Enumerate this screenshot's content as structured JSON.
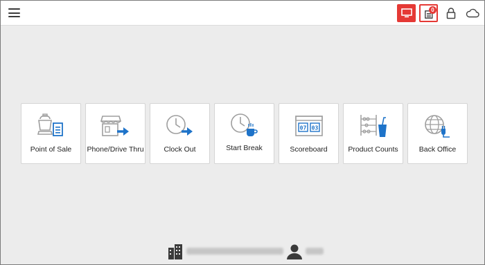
{
  "topbar": {
    "menu_icon": "hamburger-icon",
    "display_icon": "monitor-icon",
    "orders_icon": "document-list-icon",
    "orders_badge": "0",
    "lock_icon": "lock-icon",
    "cloud_icon": "cloud-icon",
    "accent_color": "#e53935"
  },
  "tiles": [
    {
      "label": "Point of Sale",
      "icon": "register-icon"
    },
    {
      "label": "Phone/Drive Thru",
      "icon": "storefront-arrow-icon"
    },
    {
      "label": "Clock Out",
      "icon": "clock-arrow-icon"
    },
    {
      "label": "Start Break",
      "icon": "clock-coffee-icon"
    },
    {
      "label": "Scoreboard",
      "icon": "scoreboard-icon"
    },
    {
      "label": "Product Counts",
      "icon": "abacus-cup-icon"
    },
    {
      "label": "Back Office",
      "icon": "globe-plug-icon"
    }
  ],
  "footer": {
    "store_icon": "building-icon",
    "user_icon": "person-icon"
  }
}
